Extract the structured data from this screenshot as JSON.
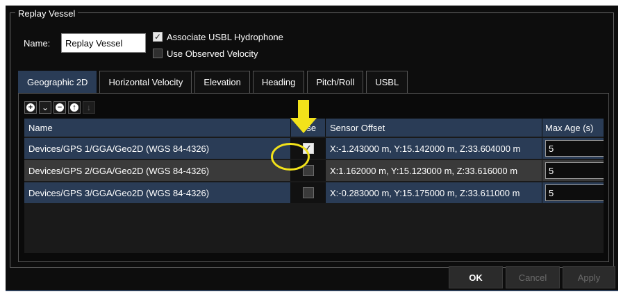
{
  "group": {
    "title": "Replay Vessel"
  },
  "name_label": "Name:",
  "name_value": "Replay Vessel",
  "options": [
    {
      "label": "Associate USBL Hydrophone",
      "checked": true
    },
    {
      "label": "Use Observed Velocity",
      "checked": false
    }
  ],
  "tabs": [
    {
      "label": "Geographic 2D",
      "active": true
    },
    {
      "label": "Horizontal Velocity",
      "active": false
    },
    {
      "label": "Elevation",
      "active": false
    },
    {
      "label": "Heading",
      "active": false
    },
    {
      "label": "Pitch/Roll",
      "active": false
    },
    {
      "label": "USBL",
      "active": false
    }
  ],
  "toolbar": {
    "add_icon": "plus-circle-icon",
    "dropdown_icon": "chevron-down-icon",
    "remove_icon": "minus-circle-icon",
    "move_up_icon": "arrow-up-icon",
    "move_down_icon": "arrow-down-icon"
  },
  "grid": {
    "columns": [
      "Name",
      "Use",
      "Sensor Offset",
      "Max Age (s)"
    ],
    "rows": [
      {
        "name": "Devices/GPS 1/GGA/Geo2D (WGS 84-4326)",
        "use": true,
        "offset": "X:-1.243000 m, Y:15.142000 m, Z:33.604000 m",
        "max_age": "5"
      },
      {
        "name": "Devices/GPS 2/GGA/Geo2D (WGS 84-4326)",
        "use": false,
        "offset": "X:1.162000 m, Y:15.123000 m, Z:33.616000 m",
        "max_age": "5"
      },
      {
        "name": "Devices/GPS 3/GGA/Geo2D (WGS 84-4326)",
        "use": false,
        "offset": "X:-0.283000 m, Y:15.175000 m, Z:33.611000 m",
        "max_age": "5"
      }
    ]
  },
  "buttons": {
    "ok": "OK",
    "cancel": "Cancel",
    "apply": "Apply"
  },
  "colors": {
    "background": "#0d0d0d",
    "selection_blue": "#2a3c56",
    "highlight_yellow": "#f2e21a"
  }
}
